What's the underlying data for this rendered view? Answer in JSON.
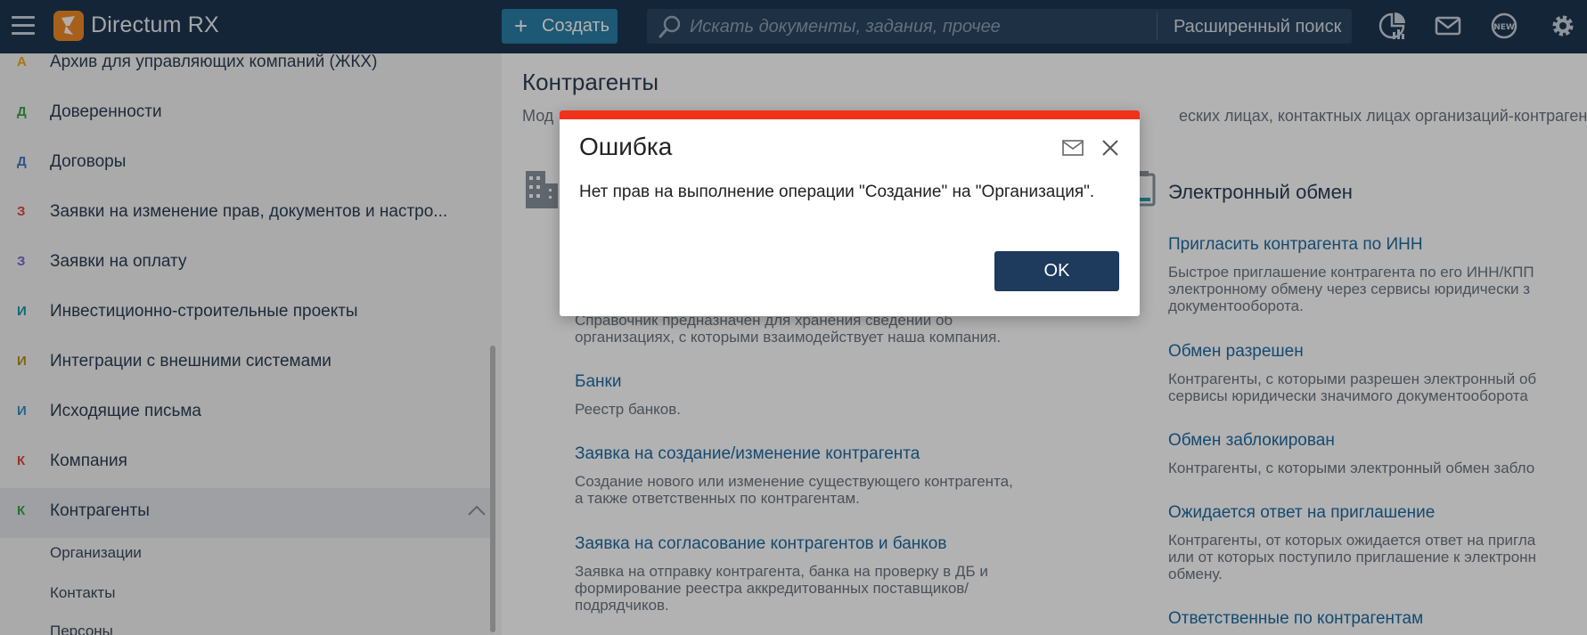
{
  "app": {
    "title": "Directum RX"
  },
  "toolbar": {
    "create_label": "Создать",
    "search_placeholder": "Искать документы, задания, прочее",
    "advanced_search_label": "Расширенный поиск"
  },
  "sidebar": {
    "items": [
      {
        "letter": "А",
        "label": "Архив для управляющих компаний (ЖКХ)",
        "color": "#f0a818"
      },
      {
        "letter": "Д",
        "label": "Доверенности",
        "color": "#3aa544"
      },
      {
        "letter": "Д",
        "label": "Договоры",
        "color": "#3b7bbf"
      },
      {
        "letter": "З",
        "label": "Заявки на изменение прав, документов и настро...",
        "color": "#e04a3a"
      },
      {
        "letter": "З",
        "label": "Заявки на оплату",
        "color": "#7a6bc9"
      },
      {
        "letter": "И",
        "label": "Инвестиционно-строительные проекты",
        "color": "#1a9ba7"
      },
      {
        "letter": "И",
        "label": "Интеграции с внешними системами",
        "color": "#b8901c"
      },
      {
        "letter": "И",
        "label": "Исходящие письма",
        "color": "#3b8fc4"
      },
      {
        "letter": "К",
        "label": "Компания",
        "color": "#e04a3a"
      },
      {
        "letter": "К",
        "label": "Контрагенты",
        "color": "#3aa544"
      }
    ],
    "subitems": [
      "Организации",
      "Контакты",
      "Персоны"
    ]
  },
  "main": {
    "title": "Контрагенты",
    "description_start": "Мод",
    "description_end": "еских лицах, контактных лицах организаций-контрагент",
    "left_links": [
      {
        "text": "",
        "desc": [
          "Справочник предназначен для хранения сведений об",
          "организациях, с которыми взаимодействует наша компания."
        ]
      },
      {
        "text": "Банки",
        "desc": [
          "Реестр банков."
        ]
      },
      {
        "text": "Заявка на создание/изменение контрагента",
        "desc": [
          "Создание нового или изменение существующего контрагента,",
          "а также ответственных по контрагентам."
        ]
      },
      {
        "text": "Заявка на согласование контрагентов и банков",
        "desc": [
          "Заявка  на отправку контрагента, банка на проверку в ДБ и",
          "формирование реестра аккредитованных поставщиков/",
          "подрядчиков."
        ]
      }
    ],
    "right_section_title": "Электронный обмен",
    "right_links": [
      {
        "text": "Пригласить контрагента по ИНН",
        "desc": [
          "Быстрое приглашение контрагента по его ИНН/КПП",
          "электронному обмену через сервисы юридически з",
          "документооборота."
        ]
      },
      {
        "text": "Обмен разрешен",
        "desc": [
          "Контрагенты, с которыми разрешен электронный об",
          "сервисы юридически значимого документооборота"
        ]
      },
      {
        "text": "Обмен заблокирован",
        "desc": [
          "Контрагенты, с которыми электронный обмен забло"
        ]
      },
      {
        "text": "Ожидается ответ на приглашение",
        "desc": [
          "Контрагенты, от которых ожидается ответ на пригла",
          "или от которых поступило приглашение к электронн",
          "обмену."
        ]
      },
      {
        "text": "Ответственные по контрагентам",
        "desc": []
      }
    ]
  },
  "dialog": {
    "title": "Ошибка",
    "message": "Нет прав на выполнение операции \"Создание\" на \"Организация\".",
    "ok_label": "OK",
    "accent_color": "#f0321b"
  }
}
